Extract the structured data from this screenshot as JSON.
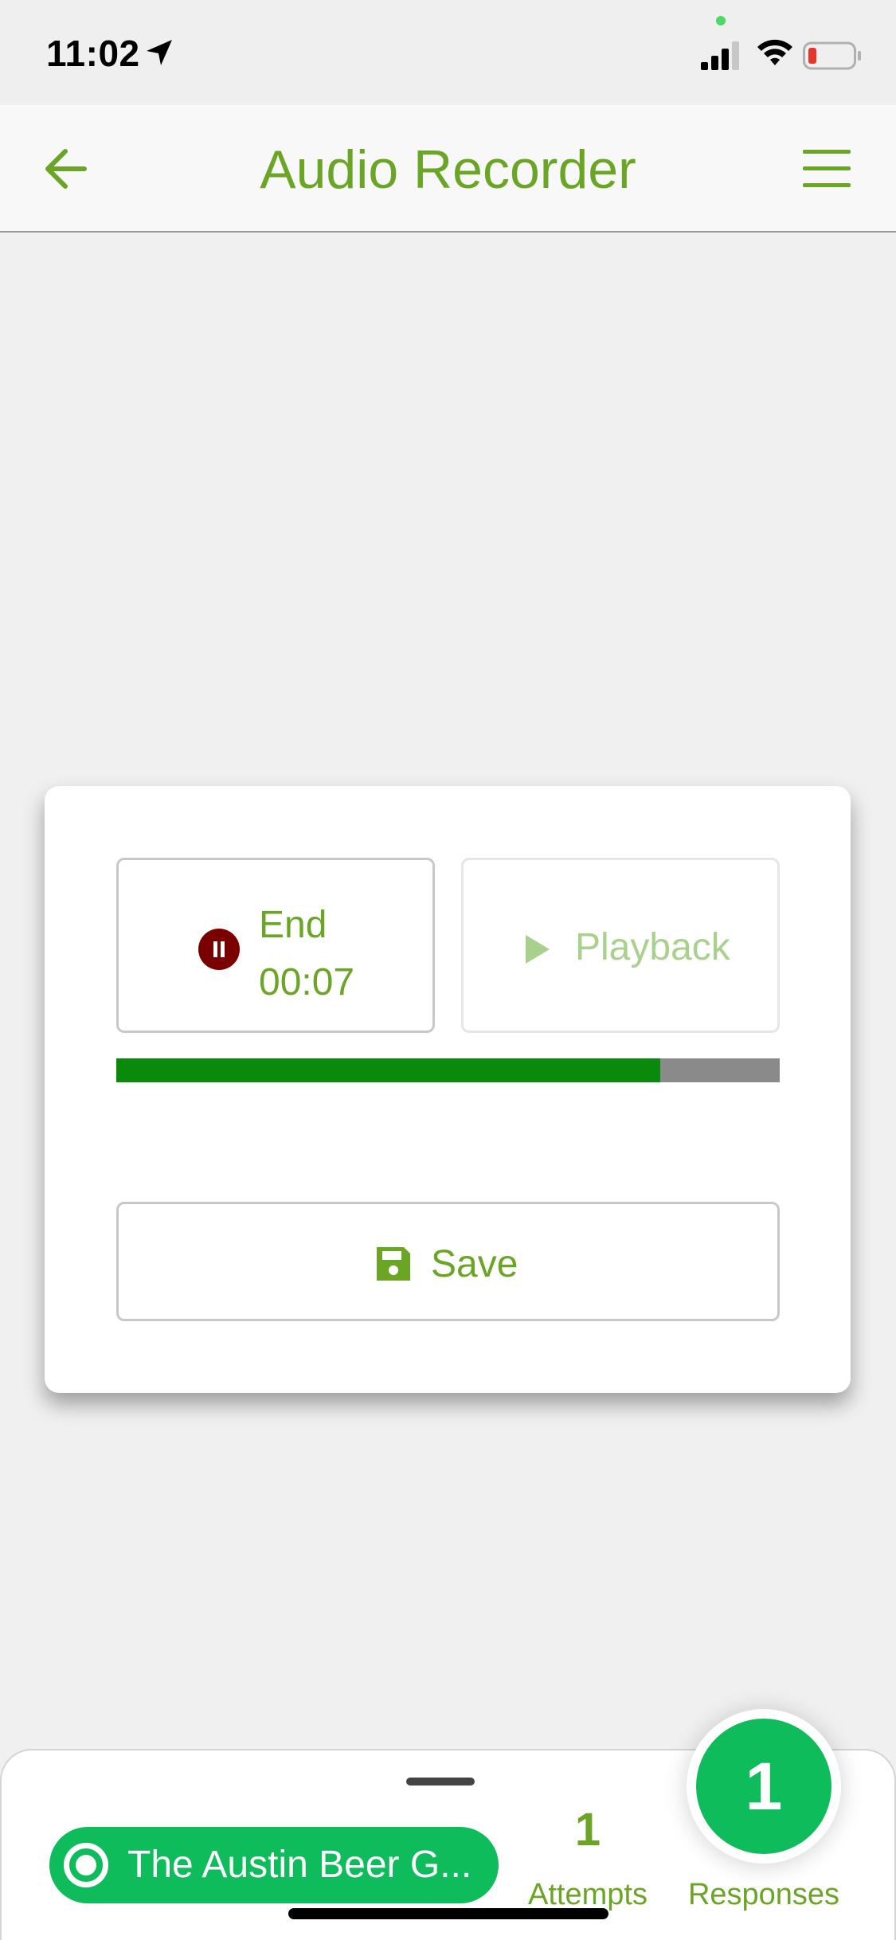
{
  "status_bar": {
    "time": "11:02",
    "icons": [
      "location-arrow-icon",
      "signal-icon",
      "wifi-icon",
      "battery-icon"
    ],
    "battery_color": "#e8352b",
    "mic_indicator_color": "#4cd964"
  },
  "nav": {
    "title": "Audio Recorder",
    "back_icon": "arrow-left-icon",
    "menu_icon": "hamburger-menu-icon",
    "accent_color": "#6aa526"
  },
  "recorder": {
    "end_label": "End",
    "elapsed_time": "00:07",
    "pause_icon": "pause-circle-icon",
    "pause_icon_color": "#7a0000",
    "playback_label": "Playback",
    "playback_icon": "play-icon",
    "progress_percent": 82,
    "progress_color": "#0a8a0a",
    "save_label": "Save",
    "save_icon": "floppy-disk-icon"
  },
  "bottom_sheet": {
    "location_label": "The Austin Beer G...",
    "location_icon": "target-icon",
    "attempts_count": "1",
    "attempts_label": "Attempts",
    "responses_count": "1",
    "responses_label": "Responses",
    "pill_color": "#0ebc5c"
  }
}
